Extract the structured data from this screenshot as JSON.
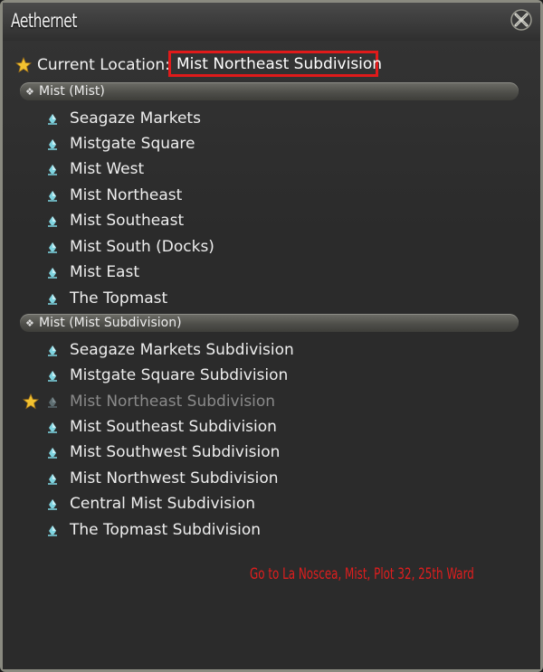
{
  "window": {
    "title": "Aethernet"
  },
  "current_location": {
    "label": "Current Location:",
    "value": "Mist Northeast Subdivision"
  },
  "groups": [
    {
      "header": "Mist (Mist)",
      "items": [
        "Seagaze Markets",
        "Mistgate Square",
        "Mist West",
        "Mist Northeast",
        "Mist Southeast",
        "Mist South (Docks)",
        "Mist East",
        "The Topmast"
      ]
    },
    {
      "header": "Mist (Mist Subdivision)",
      "items": [
        "Seagaze Markets Subdivision",
        "Mistgate Square Subdivision",
        "Mist Northeast Subdivision",
        "Mist Southeast Subdivision",
        "Mist Southwest Subdivision",
        "Mist Northwest Subdivision",
        "Central Mist Subdivision",
        "The Topmast Subdivision"
      ]
    }
  ],
  "annotation": "Go to La Noscea, Mist, Plot 32, 25th Ward",
  "colors": {
    "highlight_box": "#e01a1a",
    "annotation_text": "#e01e1e",
    "current_item_text": "#8a8a8a",
    "star": "#f2c230",
    "crystal": "#7fd4e0"
  },
  "icons": {
    "close": "close-crossed-swords-icon",
    "favorite": "star-icon",
    "aetheryte": "aetheryte-crystal-icon",
    "group": "diamond-bullet-icon"
  }
}
